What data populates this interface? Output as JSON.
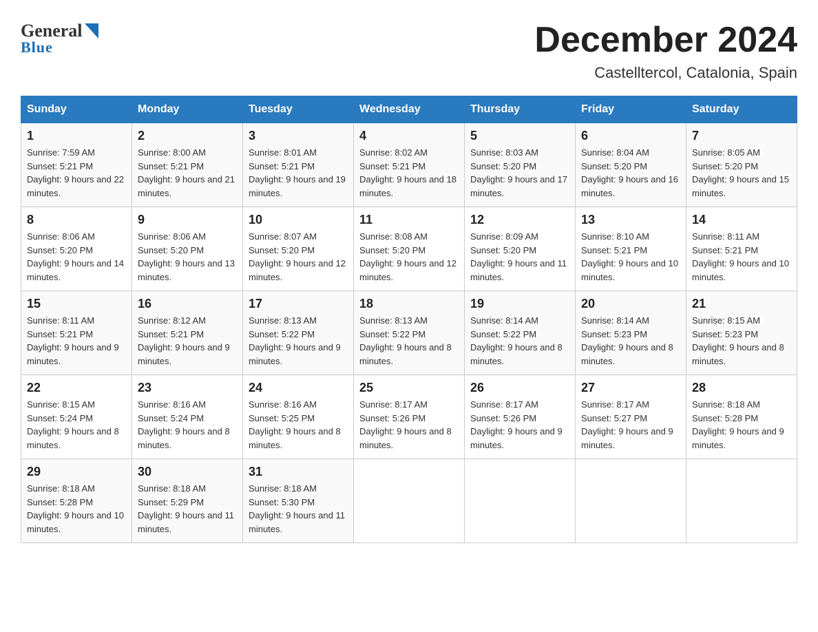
{
  "header": {
    "logo_general": "General",
    "logo_blue": "Blue",
    "title": "December 2024",
    "subtitle": "Castelltercol, Catalonia, Spain"
  },
  "days_of_week": [
    "Sunday",
    "Monday",
    "Tuesday",
    "Wednesday",
    "Thursday",
    "Friday",
    "Saturday"
  ],
  "weeks": [
    [
      {
        "num": "1",
        "sunrise": "7:59 AM",
        "sunset": "5:21 PM",
        "daylight": "9 hours and 22 minutes."
      },
      {
        "num": "2",
        "sunrise": "8:00 AM",
        "sunset": "5:21 PM",
        "daylight": "9 hours and 21 minutes."
      },
      {
        "num": "3",
        "sunrise": "8:01 AM",
        "sunset": "5:21 PM",
        "daylight": "9 hours and 19 minutes."
      },
      {
        "num": "4",
        "sunrise": "8:02 AM",
        "sunset": "5:21 PM",
        "daylight": "9 hours and 18 minutes."
      },
      {
        "num": "5",
        "sunrise": "8:03 AM",
        "sunset": "5:20 PM",
        "daylight": "9 hours and 17 minutes."
      },
      {
        "num": "6",
        "sunrise": "8:04 AM",
        "sunset": "5:20 PM",
        "daylight": "9 hours and 16 minutes."
      },
      {
        "num": "7",
        "sunrise": "8:05 AM",
        "sunset": "5:20 PM",
        "daylight": "9 hours and 15 minutes."
      }
    ],
    [
      {
        "num": "8",
        "sunrise": "8:06 AM",
        "sunset": "5:20 PM",
        "daylight": "9 hours and 14 minutes."
      },
      {
        "num": "9",
        "sunrise": "8:06 AM",
        "sunset": "5:20 PM",
        "daylight": "9 hours and 13 minutes."
      },
      {
        "num": "10",
        "sunrise": "8:07 AM",
        "sunset": "5:20 PM",
        "daylight": "9 hours and 12 minutes."
      },
      {
        "num": "11",
        "sunrise": "8:08 AM",
        "sunset": "5:20 PM",
        "daylight": "9 hours and 12 minutes."
      },
      {
        "num": "12",
        "sunrise": "8:09 AM",
        "sunset": "5:20 PM",
        "daylight": "9 hours and 11 minutes."
      },
      {
        "num": "13",
        "sunrise": "8:10 AM",
        "sunset": "5:21 PM",
        "daylight": "9 hours and 10 minutes."
      },
      {
        "num": "14",
        "sunrise": "8:11 AM",
        "sunset": "5:21 PM",
        "daylight": "9 hours and 10 minutes."
      }
    ],
    [
      {
        "num": "15",
        "sunrise": "8:11 AM",
        "sunset": "5:21 PM",
        "daylight": "9 hours and 9 minutes."
      },
      {
        "num": "16",
        "sunrise": "8:12 AM",
        "sunset": "5:21 PM",
        "daylight": "9 hours and 9 minutes."
      },
      {
        "num": "17",
        "sunrise": "8:13 AM",
        "sunset": "5:22 PM",
        "daylight": "9 hours and 9 minutes."
      },
      {
        "num": "18",
        "sunrise": "8:13 AM",
        "sunset": "5:22 PM",
        "daylight": "9 hours and 8 minutes."
      },
      {
        "num": "19",
        "sunrise": "8:14 AM",
        "sunset": "5:22 PM",
        "daylight": "9 hours and 8 minutes."
      },
      {
        "num": "20",
        "sunrise": "8:14 AM",
        "sunset": "5:23 PM",
        "daylight": "9 hours and 8 minutes."
      },
      {
        "num": "21",
        "sunrise": "8:15 AM",
        "sunset": "5:23 PM",
        "daylight": "9 hours and 8 minutes."
      }
    ],
    [
      {
        "num": "22",
        "sunrise": "8:15 AM",
        "sunset": "5:24 PM",
        "daylight": "9 hours and 8 minutes."
      },
      {
        "num": "23",
        "sunrise": "8:16 AM",
        "sunset": "5:24 PM",
        "daylight": "9 hours and 8 minutes."
      },
      {
        "num": "24",
        "sunrise": "8:16 AM",
        "sunset": "5:25 PM",
        "daylight": "9 hours and 8 minutes."
      },
      {
        "num": "25",
        "sunrise": "8:17 AM",
        "sunset": "5:26 PM",
        "daylight": "9 hours and 8 minutes."
      },
      {
        "num": "26",
        "sunrise": "8:17 AM",
        "sunset": "5:26 PM",
        "daylight": "9 hours and 9 minutes."
      },
      {
        "num": "27",
        "sunrise": "8:17 AM",
        "sunset": "5:27 PM",
        "daylight": "9 hours and 9 minutes."
      },
      {
        "num": "28",
        "sunrise": "8:18 AM",
        "sunset": "5:28 PM",
        "daylight": "9 hours and 9 minutes."
      }
    ],
    [
      {
        "num": "29",
        "sunrise": "8:18 AM",
        "sunset": "5:28 PM",
        "daylight": "9 hours and 10 minutes."
      },
      {
        "num": "30",
        "sunrise": "8:18 AM",
        "sunset": "5:29 PM",
        "daylight": "9 hours and 11 minutes."
      },
      {
        "num": "31",
        "sunrise": "8:18 AM",
        "sunset": "5:30 PM",
        "daylight": "9 hours and 11 minutes."
      },
      null,
      null,
      null,
      null
    ]
  ],
  "labels": {
    "sunrise": "Sunrise:",
    "sunset": "Sunset:",
    "daylight": "Daylight:"
  }
}
